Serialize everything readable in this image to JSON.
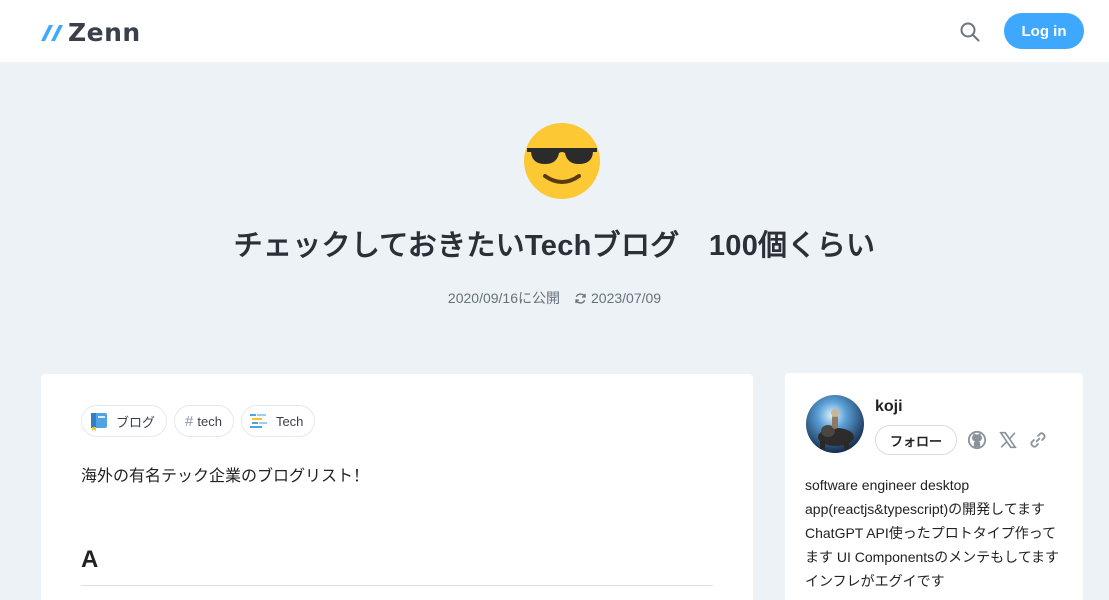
{
  "header": {
    "logo_text": "Zenn",
    "login_label": "Log in"
  },
  "article": {
    "emoji": "sunglasses-face",
    "title": "チェックしておきたいTechブログ　100個くらい",
    "published": "2020/09/16に公開",
    "updated": "2023/07/09",
    "topics": [
      {
        "label": "ブログ",
        "icon": "book-icon"
      },
      {
        "label": "tech",
        "icon": "hash-icon"
      },
      {
        "label": "Tech",
        "icon": "code-lines-icon"
      }
    ],
    "intro": "海外の有名テック企業のブログリスト！",
    "section_heading": "A"
  },
  "author": {
    "name": "koji",
    "follow_label": "フォロー",
    "bio": "software engineer desktop app(reactjs&typescript)の開発してます ChatGPT API使ったプロトタイプ作ってます UI Componentsのメンテもしてます インフレがエグイです"
  },
  "colors": {
    "accent": "#3ea8ff",
    "background": "#edf2f7"
  }
}
